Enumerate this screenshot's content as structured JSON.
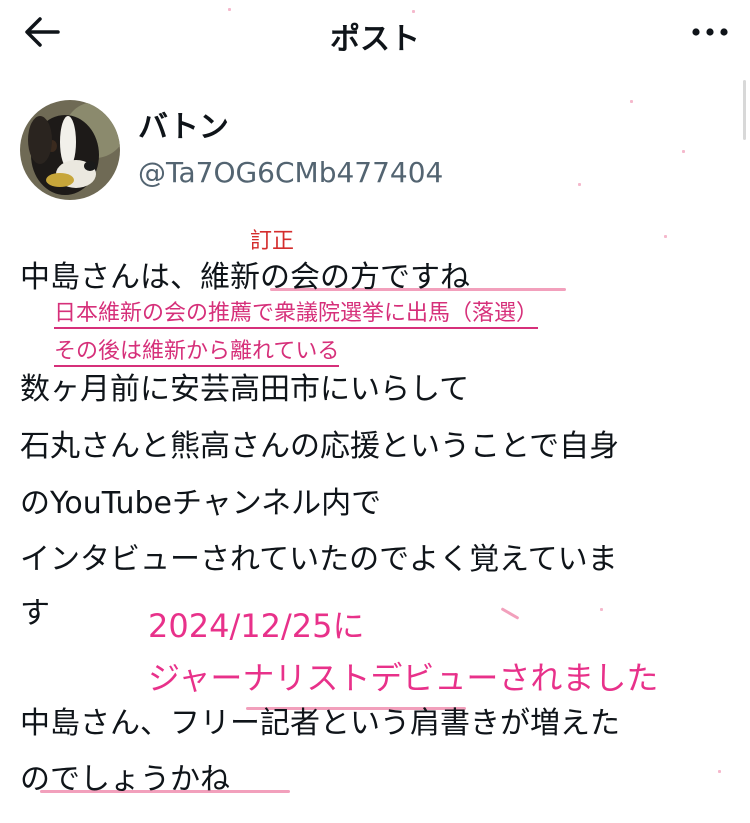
{
  "header": {
    "title": "ポスト",
    "back_icon": "arrow-left-icon",
    "more_icon": "more-horizontal-icon"
  },
  "author": {
    "display_name": "バトン",
    "handle": "@Ta7OG6CMb477404",
    "avatar_icon": "dog-avatar"
  },
  "post": {
    "lines": [
      "中島さんは、維新の会の方ですね",
      "数ヶ月前に安芸高田市にいらして",
      "石丸さんと熊高さんの応援ということで自身",
      "のYouTubeチャンネル内で",
      "インタビューされていたのでよく覚えていま",
      "す",
      "中島さん、フリー記者という肩書きが増えた",
      "のでしょうかね"
    ]
  },
  "annotations": {
    "correction_label": "訂正",
    "note_line1": "日本維新の会の推薦で衆議院選挙に出馬（落選）",
    "note_line2": "その後は維新から離れている",
    "date_line": "2024/12/25に",
    "debut_line": "ジャーナリストデビューされました"
  },
  "colors": {
    "text": "#0f1419",
    "secondary": "#536471",
    "annotation_pink": "#d6307a",
    "annotation_red": "#d42d2d"
  }
}
